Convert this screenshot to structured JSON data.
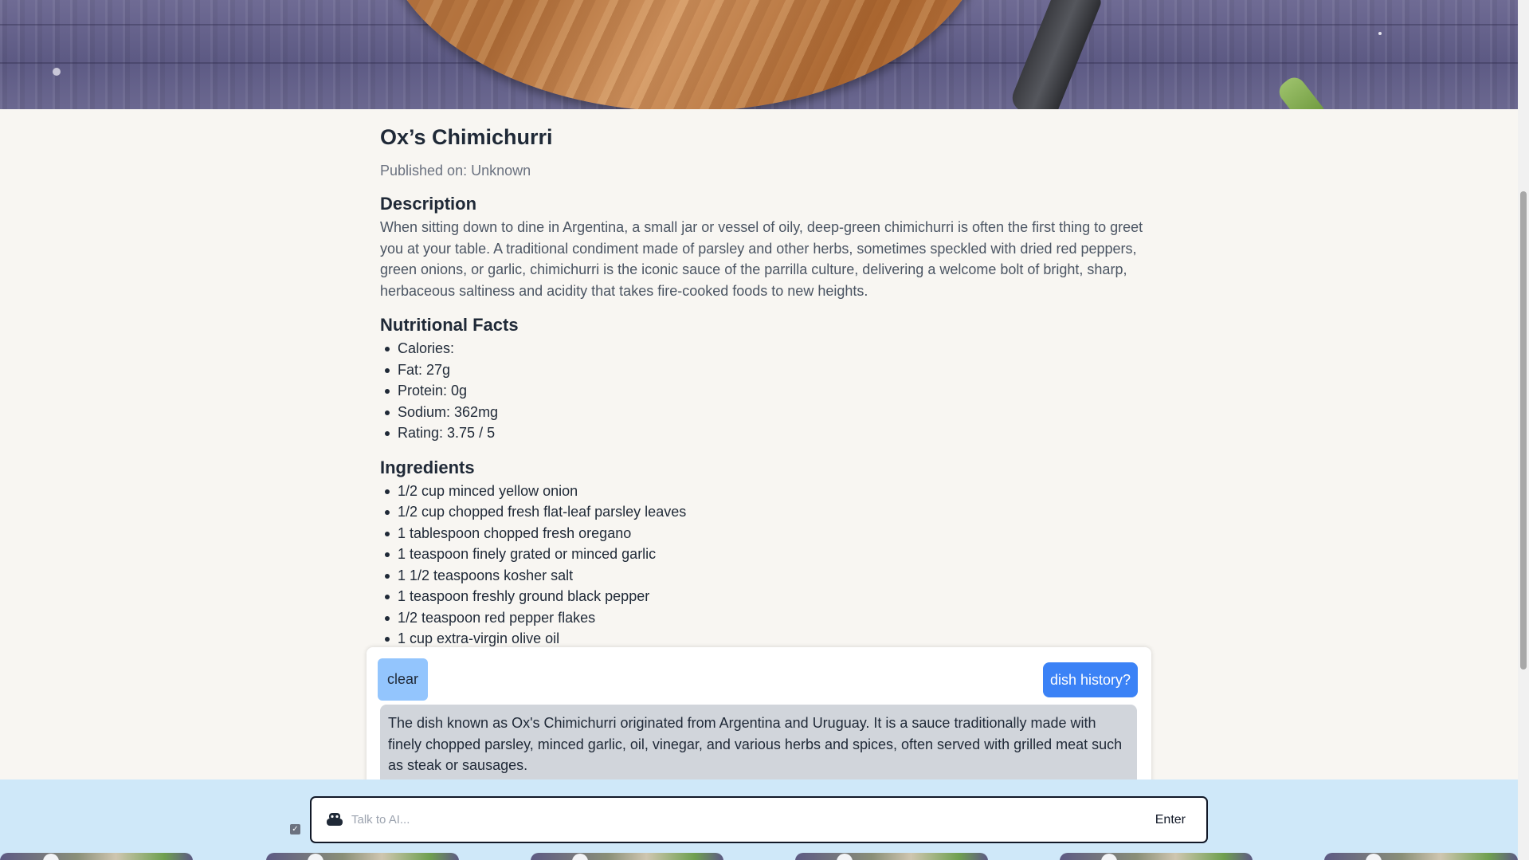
{
  "recipe": {
    "title": "Ox’s Chimichurri",
    "published": "Published on: Unknown",
    "description_heading": "Description",
    "description": "When sitting down to dine in Argentina, a small jar or vessel of oily, deep-green chimichurri is often the first thing to greet you at your table. A traditional condiment made of parsley and other herbs, sometimes speckled with dried red peppers, green onions, or garlic, chimichurri is the iconic sauce of the parrilla culture, delivering a welcome bolt of bright, sharp, herbaceous saltiness and acidity that takes fire-cooked foods to new heights.",
    "facts_heading": "Nutritional Facts",
    "facts": [
      "Calories:",
      "Fat: 27g",
      "Protein: 0g",
      "Sodium: 362mg",
      "Rating: 3.75 / 5"
    ],
    "ingredients_heading": "Ingredients",
    "ingredients": [
      "1/2 cup minced yellow onion",
      "1/2 cup chopped fresh flat-leaf parsley leaves",
      "1 tablespoon chopped fresh oregano",
      "1 teaspoon finely grated or minced garlic",
      "1 1/2 teaspoons kosher salt",
      "1 teaspoon freshly ground black pepper",
      "1/2 teaspoon red pepper flakes",
      "1 cup extra-virgin olive oil"
    ]
  },
  "chat": {
    "clear_label": "clear",
    "user_message": "dish history?",
    "ai_message": "The dish known as Ox's Chimichurri originated from Argentina and Uruguay. It is a sauce traditionally made with finely chopped parsley, minced garlic, oil, vinegar, and various herbs and spices, often served with grilled meat such as steak or sausages.",
    "input_placeholder": "Talk to AI...",
    "input_value": "",
    "enter_label": "Enter"
  },
  "colors": {
    "accent": "#3b82f6",
    "clear_button": "#93c5fd",
    "ai_bubble": "#d1d5db",
    "bottom_bar": "#cfe8f9",
    "page_background": "#f8f6f2"
  }
}
